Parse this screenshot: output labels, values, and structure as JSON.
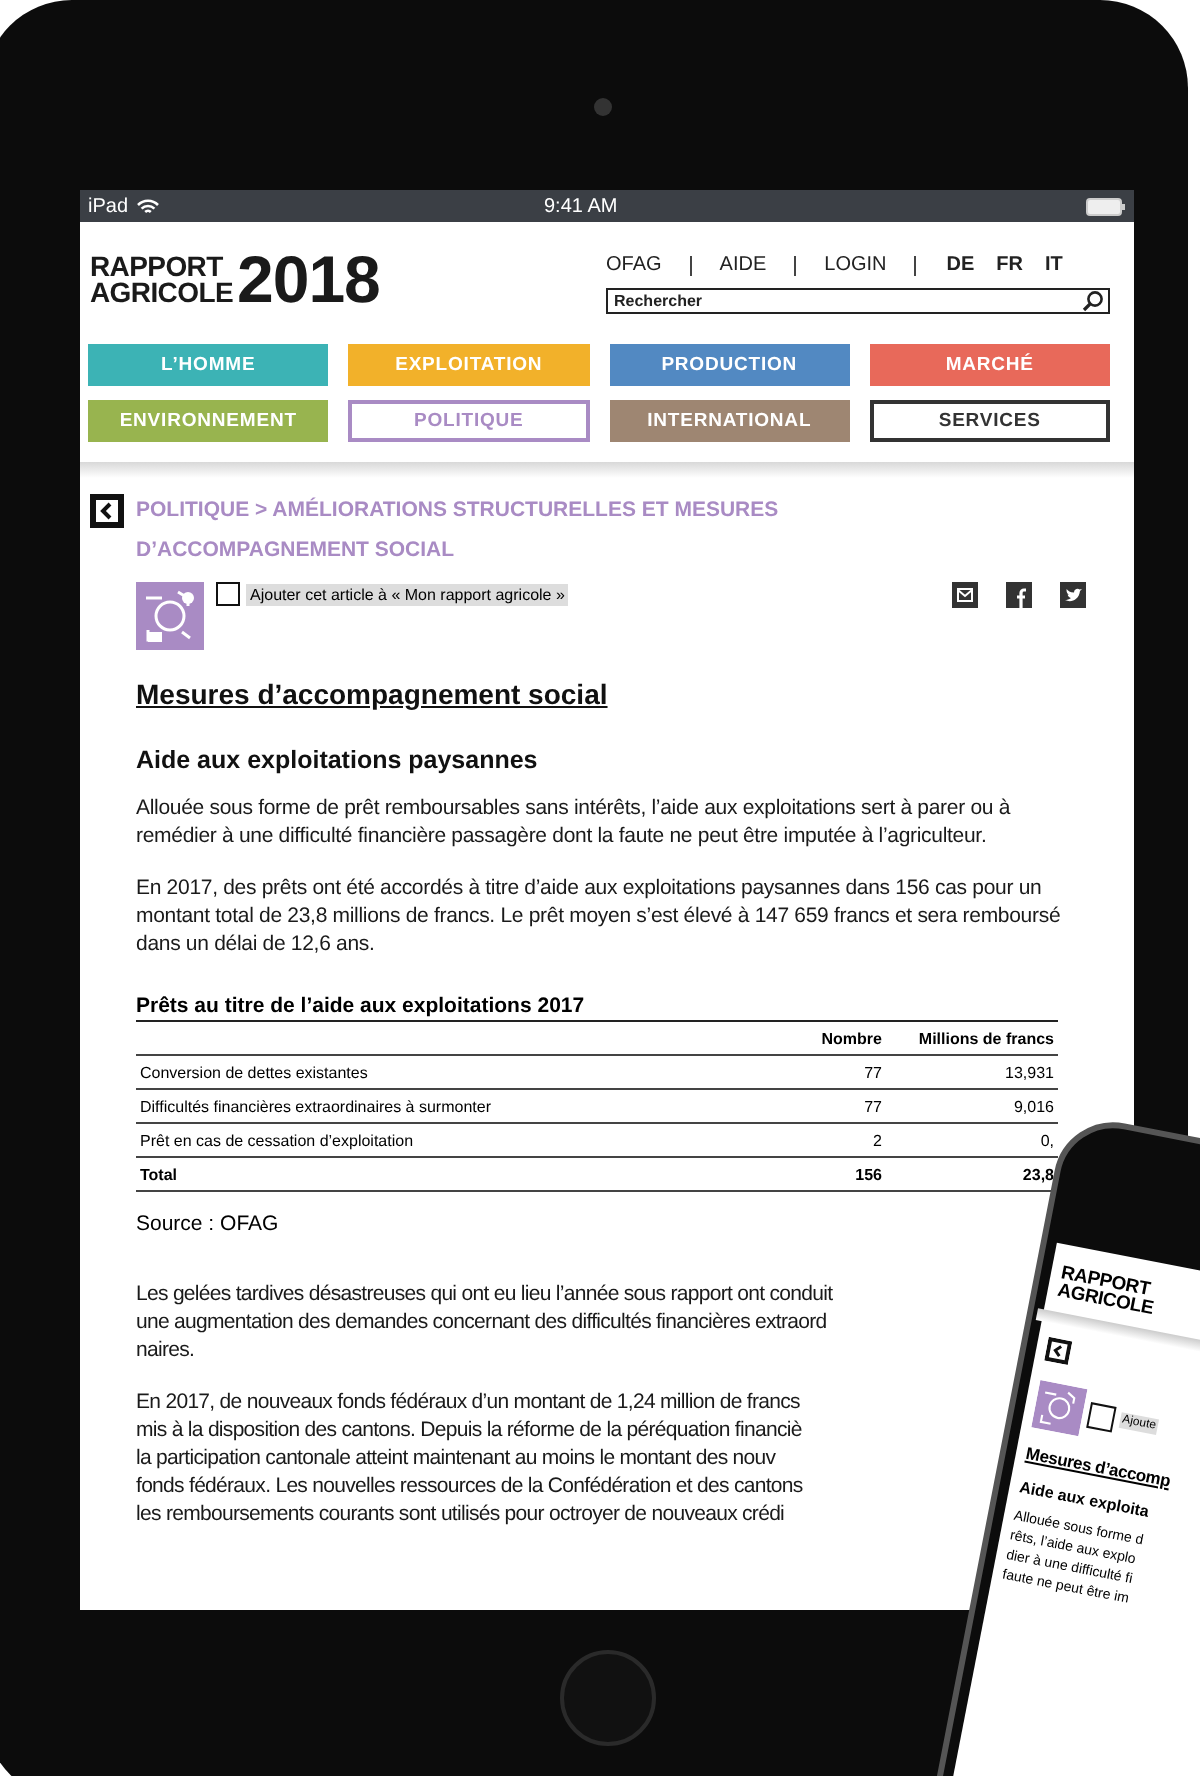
{
  "status_bar": {
    "carrier": "iPad",
    "time": "9:41 AM"
  },
  "header": {
    "logo_words": [
      "RAPPORT",
      "AGRICOLE"
    ],
    "logo_year": "2018",
    "links": [
      "OFAG",
      "AIDE",
      "LOGIN"
    ],
    "languages": [
      "DE",
      "FR",
      "IT"
    ],
    "search": {
      "placeholder": "Rechercher"
    }
  },
  "nav": [
    {
      "label": "L’HOMME",
      "kind": "filled",
      "color": "#3cb3b5"
    },
    {
      "label": "EXPLOITATION",
      "kind": "filled",
      "color": "#f2b12a"
    },
    {
      "label": "PRODUCTION",
      "kind": "filled",
      "color": "#5289c2"
    },
    {
      "label": "MARCHÉ",
      "kind": "filled",
      "color": "#e8695a"
    },
    {
      "label": "ENVIRONNEMENT",
      "kind": "filled",
      "color": "#98b44f"
    },
    {
      "label": "POLITIQUE",
      "kind": "outline",
      "color": "#a98bc4"
    },
    {
      "label": "INTERNATIONAL",
      "kind": "filled",
      "color": "#9e8672"
    },
    {
      "label": "SERVICES",
      "kind": "outline",
      "color": "#333333"
    }
  ],
  "breadcrumb": "POLITIQUE > AMÉLIORATIONS STRUCTURELLES ET MESURES D’ACCOMPAGNEMENT SOCIAL",
  "add_article": {
    "label": "Ajouter cet article à « Mon rapport agricole »",
    "checked": false
  },
  "title": "Mesures d’accompagnement social",
  "subtitle": "Aide aux exploitations paysannes",
  "paragraphs": [
    {
      "lines": [
        "Allouée sous forme de prêt remboursables sans intérêts, l’aide aux exploitations sert à parer ou à remédier à une difficulté financière passagère dont la faute ne peut être imputée à l’agriculteur."
      ]
    },
    {
      "lines": [
        "En 2017, des prêts ont été accordés à titre d’aide aux exploitations paysannes dans 156 cas pour un montant total de 23,8 millions de francs. Le prêt moyen s’est élevé à 147 659 francs et sera remboursé dans un délai de 12,6 ans."
      ]
    }
  ],
  "table": {
    "title": "Prêts au titre de l’aide aux exploitations 2017",
    "columns": [
      "",
      "Nombre",
      "Millions de francs"
    ],
    "rows": [
      {
        "kind": "normal",
        "cells": [
          "Conversion de dettes existantes",
          "77",
          "13,931"
        ]
      },
      {
        "kind": "normal",
        "cells": [
          "Difficultés financières extraordinaires à surmonter",
          "77",
          "9,016"
        ]
      },
      {
        "kind": "normal",
        "cells": [
          "Prêt en cas de cessation d’exploitation",
          "2",
          "0,"
        ]
      },
      {
        "kind": "total",
        "cells": [
          "Total",
          "156",
          "23,8"
        ]
      }
    ],
    "source": "Source : OFAG"
  },
  "cut_paragraphs": [
    {
      "lines": [
        "Les gelées tardives désastreuses qui ont eu lieu l’année sous rapport ont conduit",
        "une augmentation des demandes concernant des difficultés financières extraord",
        "naires."
      ]
    },
    {
      "lines": [
        "En 2017, de nouveaux fonds fédéraux d’un montant de 1,24 million de francs",
        "mis à la disposition des cantons. Depuis la réforme de la péréquation financiè",
        "la participation cantonale atteint maintenant au moins le montant des nouv",
        "fonds fédéraux. Les nouvelles ressources de la Confédération et des cantons",
        "les remboursements courants sont utilisés pour octroyer de nouveaux crédi"
      ]
    }
  ],
  "phone": {
    "logo_words": [
      "RAPPORT",
      "AGRICOLE"
    ],
    "add_label": "Ajoute",
    "checked": false,
    "title": "Mesures d’accomp",
    "subtitle": "Aide aux exploita",
    "lines": [
      "Allouée sous forme d",
      "rêts, l’aide aux explo",
      "dier à une difficulté fi",
      "faute ne peut être im"
    ]
  }
}
